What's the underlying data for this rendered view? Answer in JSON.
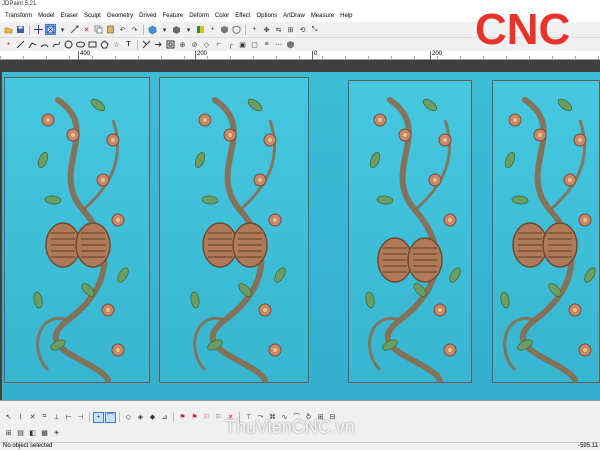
{
  "window": {
    "title": "JDPaint 5.21"
  },
  "menu": [
    "Transform",
    "Model",
    "Eraser",
    "Sculpt",
    "Geometry",
    "Drived",
    "Feature",
    "Deform",
    "Color",
    "Effect",
    "Options",
    "ArtDraw",
    "Measure",
    "Help"
  ],
  "ruler": {
    "labels": [
      "400",
      "200",
      "0",
      "200"
    ]
  },
  "watermark": {
    "logo_text": "CNC",
    "logo_sub": "THU VIEN CNC.VN",
    "bottom_text": "ThuVienCNC.vn"
  },
  "status": {
    "left": "No object selected",
    "right": "-595.11"
  },
  "colors": {
    "accent": "#e8322b",
    "relief": "#3bbcd6",
    "toolbar": "#f0f0f0"
  }
}
